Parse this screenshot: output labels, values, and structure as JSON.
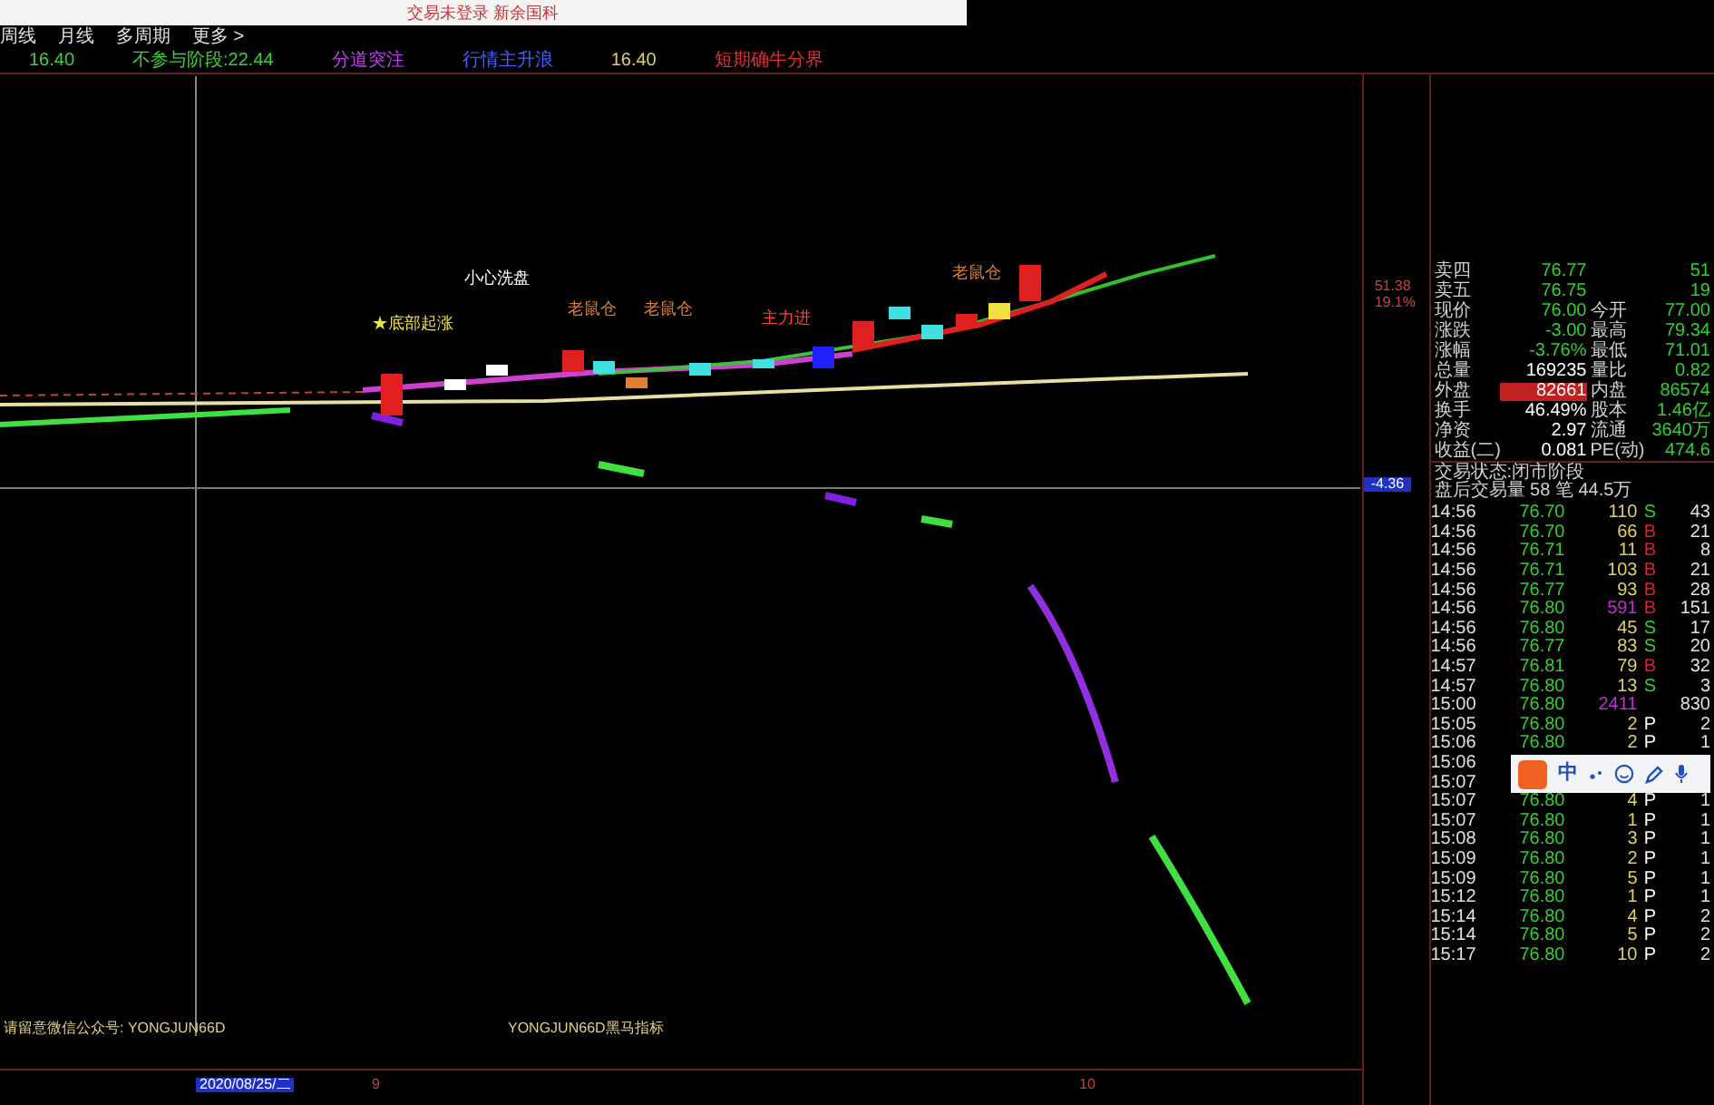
{
  "title_bar": {
    "title": "交易未登录 新余国科"
  },
  "period_tabs": [
    {
      "label": "周线",
      "selected": false
    },
    {
      "label": "月线",
      "selected": false
    },
    {
      "label": "多周期",
      "selected": false
    },
    {
      "label": "更多 >",
      "selected": false
    }
  ],
  "indicator_line": [
    {
      "text": "16.40",
      "kind": "green"
    },
    {
      "text": "不参与阶段:22.44",
      "kind": "green"
    },
    {
      "text": "分道突注",
      "kind": "purple"
    },
    {
      "text": "行情主升浪",
      "kind": "blue"
    },
    {
      "text": "16.40",
      "kind": "yellow"
    },
    {
      "text": "短期确牛分界",
      "kind": "red"
    }
  ],
  "chart_labels": [
    {
      "text": "小心洗盘",
      "kind": "white"
    },
    {
      "text": "老鼠仓",
      "kind": "orange"
    },
    {
      "text": "老鼠仓",
      "kind": "orange"
    },
    {
      "text": "主力进",
      "kind": "red"
    },
    {
      "text": "老鼠仓",
      "kind": "orange"
    },
    {
      "text": "★底部起涨",
      "kind": "yellow"
    }
  ],
  "axis_labels": {
    "top_price": "51.38",
    "top_percent": "19.1%",
    "cursor_value": "-4.36"
  },
  "quote_panel": {
    "rows": [
      {
        "label": "卖四",
        "value": "76.77",
        "kind": "down",
        "label2": "",
        "value2": "51"
      },
      {
        "label": "卖五",
        "value": "76.75",
        "kind": "down",
        "label2": "",
        "value2": "19"
      },
      {
        "label": "现价",
        "value": "76.00",
        "kind": "down",
        "label2": "今开",
        "value2": "77.00"
      },
      {
        "label": "涨跌",
        "value": "-3.00",
        "kind": "down",
        "label2": "最高",
        "value2": "79.34"
      },
      {
        "label": "涨幅",
        "value": "-3.76%",
        "kind": "down",
        "label2": "最低",
        "value2": "71.01"
      },
      {
        "label": "总量",
        "value": "169235",
        "kind": "neutral",
        "label2": "量比",
        "value2": "0.82"
      },
      {
        "label": "外盘",
        "value": "82661",
        "kind": "up",
        "label2": "内盘",
        "value2": "86574"
      },
      {
        "label": "换手",
        "value": "46.49%",
        "kind": "neutral",
        "label2": "股本",
        "value2": "1.46亿"
      },
      {
        "label": "净资",
        "value": "2.97",
        "kind": "neutral",
        "label2": "流通",
        "value2": "3640万"
      },
      {
        "label": "收益(二)",
        "value": "0.081",
        "kind": "neutral",
        "label2": "PE(动)",
        "value2": "474.6"
      }
    ],
    "status": "交易状态:闭市阶段",
    "after_hours": "盘后交易量 58 笔 44.5万"
  },
  "ticks": [
    {
      "time": "14:56",
      "price": "76.70",
      "volume": "110",
      "flag": "S",
      "kind": "sell",
      "highlight": false,
      "count": "43"
    },
    {
      "time": "14:56",
      "price": "76.70",
      "volume": "66",
      "flag": "B",
      "kind": "buy",
      "highlight": false,
      "count": "21"
    },
    {
      "time": "14:56",
      "price": "76.71",
      "volume": "11",
      "flag": "B",
      "kind": "buy",
      "highlight": false,
      "count": "8"
    },
    {
      "time": "14:56",
      "price": "76.71",
      "volume": "103",
      "flag": "B",
      "kind": "buy",
      "highlight": false,
      "count": "21"
    },
    {
      "time": "14:56",
      "price": "76.77",
      "volume": "93",
      "flag": "B",
      "kind": "buy",
      "highlight": false,
      "count": "28"
    },
    {
      "time": "14:56",
      "price": "76.80",
      "volume": "591",
      "flag": "B",
      "kind": "buy",
      "highlight": true,
      "count": "151"
    },
    {
      "time": "14:56",
      "price": "76.80",
      "volume": "45",
      "flag": "S",
      "kind": "sell",
      "highlight": false,
      "count": "17"
    },
    {
      "time": "14:56",
      "price": "76.77",
      "volume": "83",
      "flag": "S",
      "kind": "sell",
      "highlight": false,
      "count": "20"
    },
    {
      "time": "14:57",
      "price": "76.81",
      "volume": "79",
      "flag": "B",
      "kind": "buy",
      "highlight": false,
      "count": "32"
    },
    {
      "time": "14:57",
      "price": "76.80",
      "volume": "13",
      "flag": "S",
      "kind": "sell",
      "highlight": false,
      "count": "3"
    },
    {
      "time": "15:00",
      "price": "76.80",
      "volume": "2411",
      "highlight": true,
      "count": "830"
    },
    {
      "time": "15:05",
      "price": "76.80",
      "volume": "2",
      "flag": "P",
      "kind": "post",
      "highlight": false,
      "count": "2"
    },
    {
      "time": "15:06",
      "price": "76.80",
      "volume": "2",
      "flag": "P",
      "kind": "post",
      "highlight": false,
      "count": "1"
    },
    {
      "time": "15:06"
    },
    {
      "time": "15:07"
    },
    {
      "time": "15:07",
      "price": "76.80",
      "volume": "4",
      "flag": "P",
      "kind": "post",
      "highlight": false,
      "count": "1"
    },
    {
      "time": "15:07",
      "price": "76.80",
      "volume": "1",
      "flag": "P",
      "kind": "post",
      "highlight": false,
      "count": "1"
    },
    {
      "time": "15:08",
      "price": "76.80",
      "volume": "3",
      "flag": "P",
      "kind": "post",
      "highlight": false,
      "count": "1"
    },
    {
      "time": "15:09",
      "price": "76.80",
      "volume": "2",
      "flag": "P",
      "kind": "post",
      "highlight": false,
      "count": "1"
    },
    {
      "time": "15:09",
      "price": "76.80",
      "volume": "5",
      "flag": "P",
      "kind": "post",
      "highlight": false,
      "count": "1"
    },
    {
      "time": "15:12",
      "price": "76.80",
      "volume": "1",
      "flag": "P",
      "kind": "post",
      "highlight": false,
      "count": "1"
    },
    {
      "time": "15:14",
      "price": "76.80",
      "volume": "4",
      "flag": "P",
      "kind": "post",
      "highlight": false,
      "count": "2"
    },
    {
      "time": "15:14",
      "price": "76.80",
      "volume": "5",
      "flag": "P",
      "kind": "post",
      "highlight": false,
      "count": "2"
    },
    {
      "time": "15:17",
      "price": "76.80",
      "volume": "10",
      "flag": "P",
      "kind": "post",
      "highlight": false,
      "count": "2"
    }
  ],
  "ime_toolbar": {
    "mode": "中"
  },
  "footer": {
    "note": "请留意微信公众号: YONGJUN66D",
    "indicator_name": "YONGJUN66D黑马指标",
    "date": "2020/08/25/二",
    "ticks": [
      "9",
      "10"
    ]
  }
}
